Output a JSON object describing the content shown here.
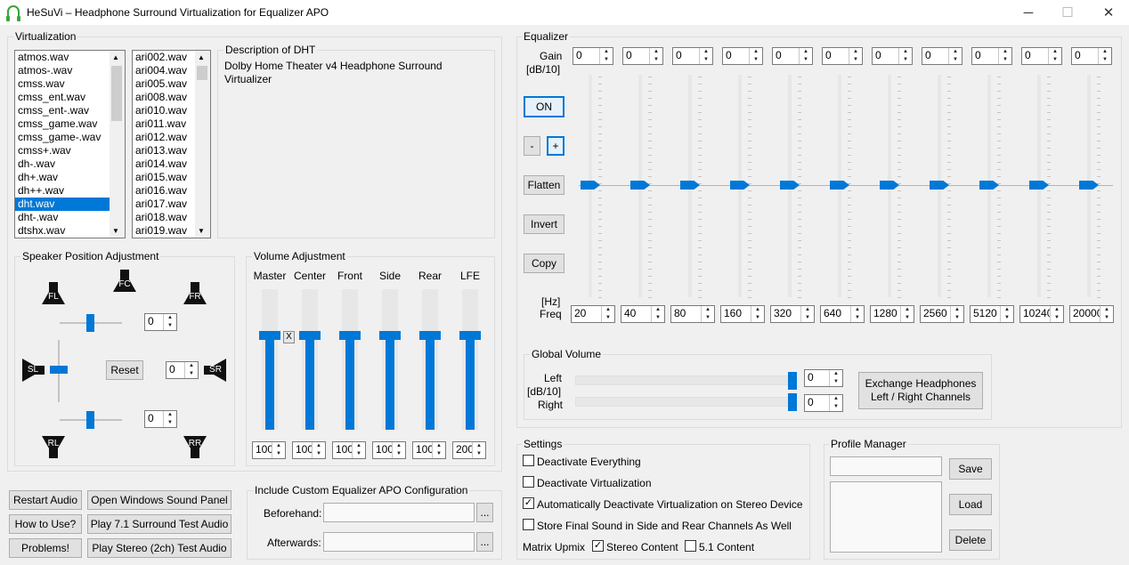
{
  "window": {
    "title": "HeSuVi – Headphone Surround Virtualization for Equalizer APO",
    "min": "─",
    "max": "☐",
    "close": "✕"
  },
  "virtualization": {
    "label": "Virtualization",
    "list1": [
      "atmos.wav",
      "atmos-.wav",
      "cmss.wav",
      "cmss_ent.wav",
      "cmss_ent-.wav",
      "cmss_game.wav",
      "cmss_game-.wav",
      "cmss+.wav",
      "dh-.wav",
      "dh+.wav",
      "dh++.wav",
      "dht.wav",
      "dht-.wav",
      "dtshx.wav"
    ],
    "list1_selected": 11,
    "list2": [
      "ari002.wav",
      "ari004.wav",
      "ari005.wav",
      "ari008.wav",
      "ari010.wav",
      "ari011.wav",
      "ari012.wav",
      "ari013.wav",
      "ari014.wav",
      "ari015.wav",
      "ari016.wav",
      "ari017.wav",
      "ari018.wav",
      "ari019.wav"
    ],
    "desc_label": "Description of DHT",
    "desc_text": "Dolby Home Theater v4 Headphone Surround Virtualizer"
  },
  "speaker": {
    "label": "Speaker Position Adjustment",
    "fl": "FL",
    "fc": "FC",
    "fr": "FR",
    "sl": "SL",
    "sr": "SR",
    "rl": "RL",
    "rr": "RR",
    "reset": "Reset",
    "v_top": "0",
    "v_mid": "0",
    "v_bot": "0"
  },
  "volume": {
    "label": "Volume Adjustment",
    "x": "X",
    "channels": [
      {
        "name": "Master",
        "value": "100",
        "level": 0.67
      },
      {
        "name": "Center",
        "value": "100",
        "level": 0.67
      },
      {
        "name": "Front",
        "value": "100",
        "level": 0.67
      },
      {
        "name": "Side",
        "value": "100",
        "level": 0.67
      },
      {
        "name": "Rear",
        "value": "100",
        "level": 0.67
      },
      {
        "name": "LFE",
        "value": "200",
        "level": 0.67
      }
    ]
  },
  "buttons": {
    "restart": "Restart Audio",
    "open_panel": "Open Windows Sound Panel",
    "how": "How to Use?",
    "play71": "Play 7.1 Surround Test Audio",
    "problems": "Problems!",
    "playstereo": "Play Stereo (2ch) Test Audio"
  },
  "custom": {
    "label": "Include Custom Equalizer APO Configuration",
    "before": "Beforehand:",
    "after": "Afterwards:",
    "browse": "..."
  },
  "equalizer": {
    "label": "Equalizer",
    "gain": "Gain",
    "gain_unit": "[dB/10]",
    "hz": "[Hz]",
    "freq": "Freq",
    "on": "ON",
    "minus": "-",
    "plus": "+",
    "flatten": "Flatten",
    "invert": "Invert",
    "copy": "Copy",
    "bands": [
      {
        "gain": "0",
        "freq": "20"
      },
      {
        "gain": "0",
        "freq": "40"
      },
      {
        "gain": "0",
        "freq": "80"
      },
      {
        "gain": "0",
        "freq": "160"
      },
      {
        "gain": "0",
        "freq": "320"
      },
      {
        "gain": "0",
        "freq": "640"
      },
      {
        "gain": "0",
        "freq": "1280"
      },
      {
        "gain": "0",
        "freq": "2560"
      },
      {
        "gain": "0",
        "freq": "5120"
      },
      {
        "gain": "0",
        "freq": "10240"
      },
      {
        "gain": "0",
        "freq": "20000"
      }
    ]
  },
  "global": {
    "label": "Global Volume",
    "left": "Left",
    "unit": "[dB/10]",
    "right": "Right",
    "left_val": "0",
    "right_val": "0",
    "exchange": "Exchange Headphones Left / Right Channels"
  },
  "settings": {
    "label": "Settings",
    "deact_all": "Deactivate Everything",
    "deact_virt": "Deactivate Virtualization",
    "auto": "Automatically Deactivate Virtualization on Stereo Device",
    "store": "Store Final Sound in Side and Rear Channels As Well",
    "upmix": "Matrix Upmix",
    "stereo": "Stereo Content",
    "c51": "5.1 Content",
    "checks": {
      "deact_all": false,
      "deact_virt": false,
      "auto": true,
      "store": false,
      "stereo": true,
      "c51": false
    }
  },
  "profile": {
    "label": "Profile Manager",
    "save": "Save",
    "load": "Load",
    "delete": "Delete"
  }
}
